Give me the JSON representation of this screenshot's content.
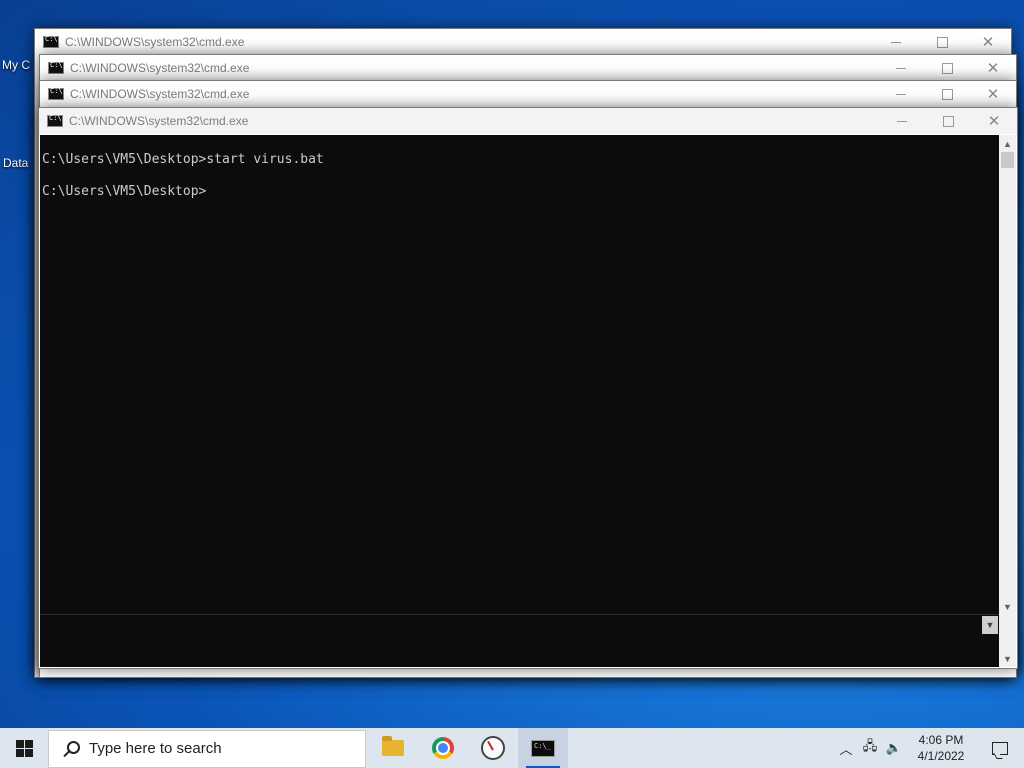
{
  "desktop": {
    "icon_my_computer_label": "My C",
    "icon_data_label": "Data"
  },
  "windows": [
    {
      "title": "C:\\WINDOWS\\system32\\cmd.exe"
    },
    {
      "title": "C:\\WINDOWS\\system32\\cmd.exe"
    },
    {
      "title": "C:\\WINDOWS\\system32\\cmd.exe"
    },
    {
      "title": "C:\\WINDOWS\\system32\\cmd.exe"
    }
  ],
  "console": {
    "lines": [
      "C:\\Users\\VM5\\Desktop>start virus.bat",
      "C:\\Users\\VM5\\Desktop>"
    ]
  },
  "taskbar": {
    "search_placeholder": "Type here to search",
    "time": "4:06 PM",
    "date": "4/1/2022",
    "apps": [
      "file-explorer-icon",
      "chrome-icon",
      "dial-app-icon",
      "cmd-icon"
    ]
  },
  "colors": {
    "console_bg": "#0c0c0c",
    "console_text": "#cccccc",
    "taskbar_bg": "#dde5ef",
    "accent": "#0b58c9"
  }
}
